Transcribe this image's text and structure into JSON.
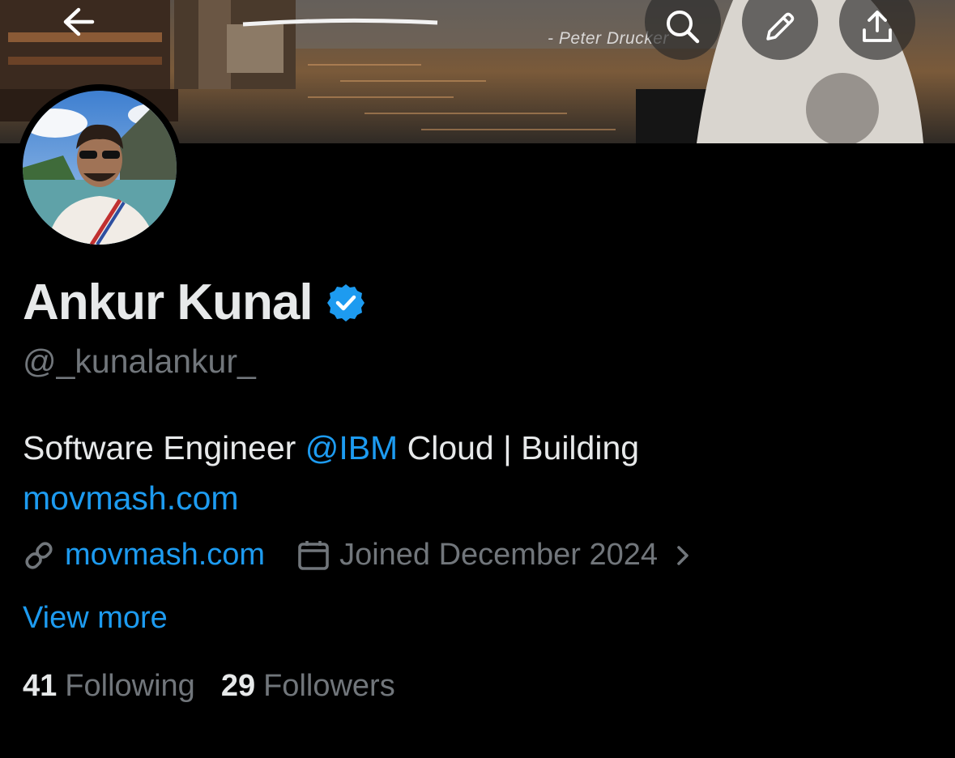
{
  "header": {
    "banner_quote": "- Peter Drucker",
    "back_icon": "arrow-left-icon",
    "search_icon": "search-icon",
    "edit_icon": "pencil-icon",
    "share_icon": "share-upload-icon"
  },
  "profile": {
    "display_name": "Ankur Kunal",
    "verified_icon": "verified-badge-icon",
    "verified_color": "#1d9bf0",
    "handle": "@_kunalankur_",
    "bio_prefix": "Software Engineer ",
    "bio_mention": "@IBM",
    "bio_middle": " Cloud | Building",
    "bio_link": "movmash.com",
    "website_icon": "link-icon",
    "website": "movmash.com",
    "calendar_icon": "calendar-icon",
    "joined": "Joined December 2024",
    "chevron_icon": "chevron-right-icon",
    "view_more": "View more",
    "following_count": "41",
    "following_label": "Following",
    "followers_count": "29",
    "followers_label": "Followers"
  },
  "colors": {
    "background": "#000000",
    "primary_text": "#e7e9ea",
    "secondary_text": "#71767b",
    "accent": "#1d9bf0"
  }
}
